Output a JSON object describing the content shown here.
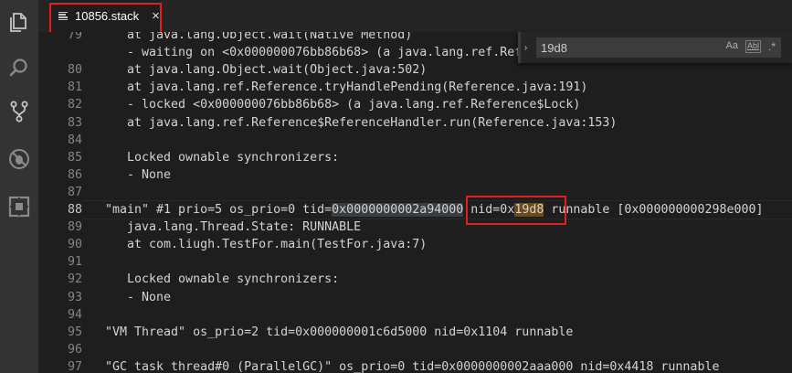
{
  "tab": {
    "filename": "10856.stack",
    "close_glyph": "×"
  },
  "activity_bar": [
    "files-icon",
    "search-icon",
    "source-control-icon",
    "debug-icon",
    "extensions-icon"
  ],
  "find": {
    "query": "19d8",
    "match_case_label": "Aa",
    "whole_word_label": "Abl",
    "regex_label": ".*"
  },
  "lines": [
    {
      "num": "79",
      "text": "   at java.lang.Object.wait(Native Method)"
    },
    {
      "num": "",
      "text": "   - waiting on <0x000000076bb86b68> (a java.lang.ref.Reference$Lock)"
    },
    {
      "num": "80",
      "text": "   at java.lang.Object.wait(Object.java:502)"
    },
    {
      "num": "81",
      "text": "   at java.lang.ref.Reference.tryHandlePending(Reference.java:191)"
    },
    {
      "num": "82",
      "text": "   - locked <0x000000076bb86b68> (a java.lang.ref.Reference$Lock)"
    },
    {
      "num": "83",
      "text": "   at java.lang.ref.Reference$ReferenceHandler.run(Reference.java:153)"
    },
    {
      "num": "84",
      "text": ""
    },
    {
      "num": "85",
      "text": "   Locked ownable synchronizers:"
    },
    {
      "num": "86",
      "text": "   - None"
    },
    {
      "num": "87",
      "text": ""
    },
    {
      "num": "88",
      "pre": "\"main\" #1 prio=5 os_prio=0 tid=",
      "sel": "0x0000000002a94000",
      "mid": " nid=0x",
      "match": "19d8",
      "post": " runnable [0x000000000298e000]"
    },
    {
      "num": "89",
      "text": "   java.lang.Thread.State: RUNNABLE"
    },
    {
      "num": "90",
      "text": "   at com.liugh.TestFor.main(TestFor.java:7)"
    },
    {
      "num": "91",
      "text": ""
    },
    {
      "num": "92",
      "text": "   Locked ownable synchronizers:"
    },
    {
      "num": "93",
      "text": "   - None"
    },
    {
      "num": "94",
      "text": ""
    },
    {
      "num": "95",
      "text": "\"VM Thread\" os_prio=2 tid=0x000000001c6d5000 nid=0x1104 runnable"
    },
    {
      "num": "96",
      "text": ""
    },
    {
      "num": "97",
      "text": "\"GC task thread#0 (ParallelGC)\" os_prio=0 tid=0x0000000002aaa000 nid=0x4418 runnable"
    }
  ]
}
